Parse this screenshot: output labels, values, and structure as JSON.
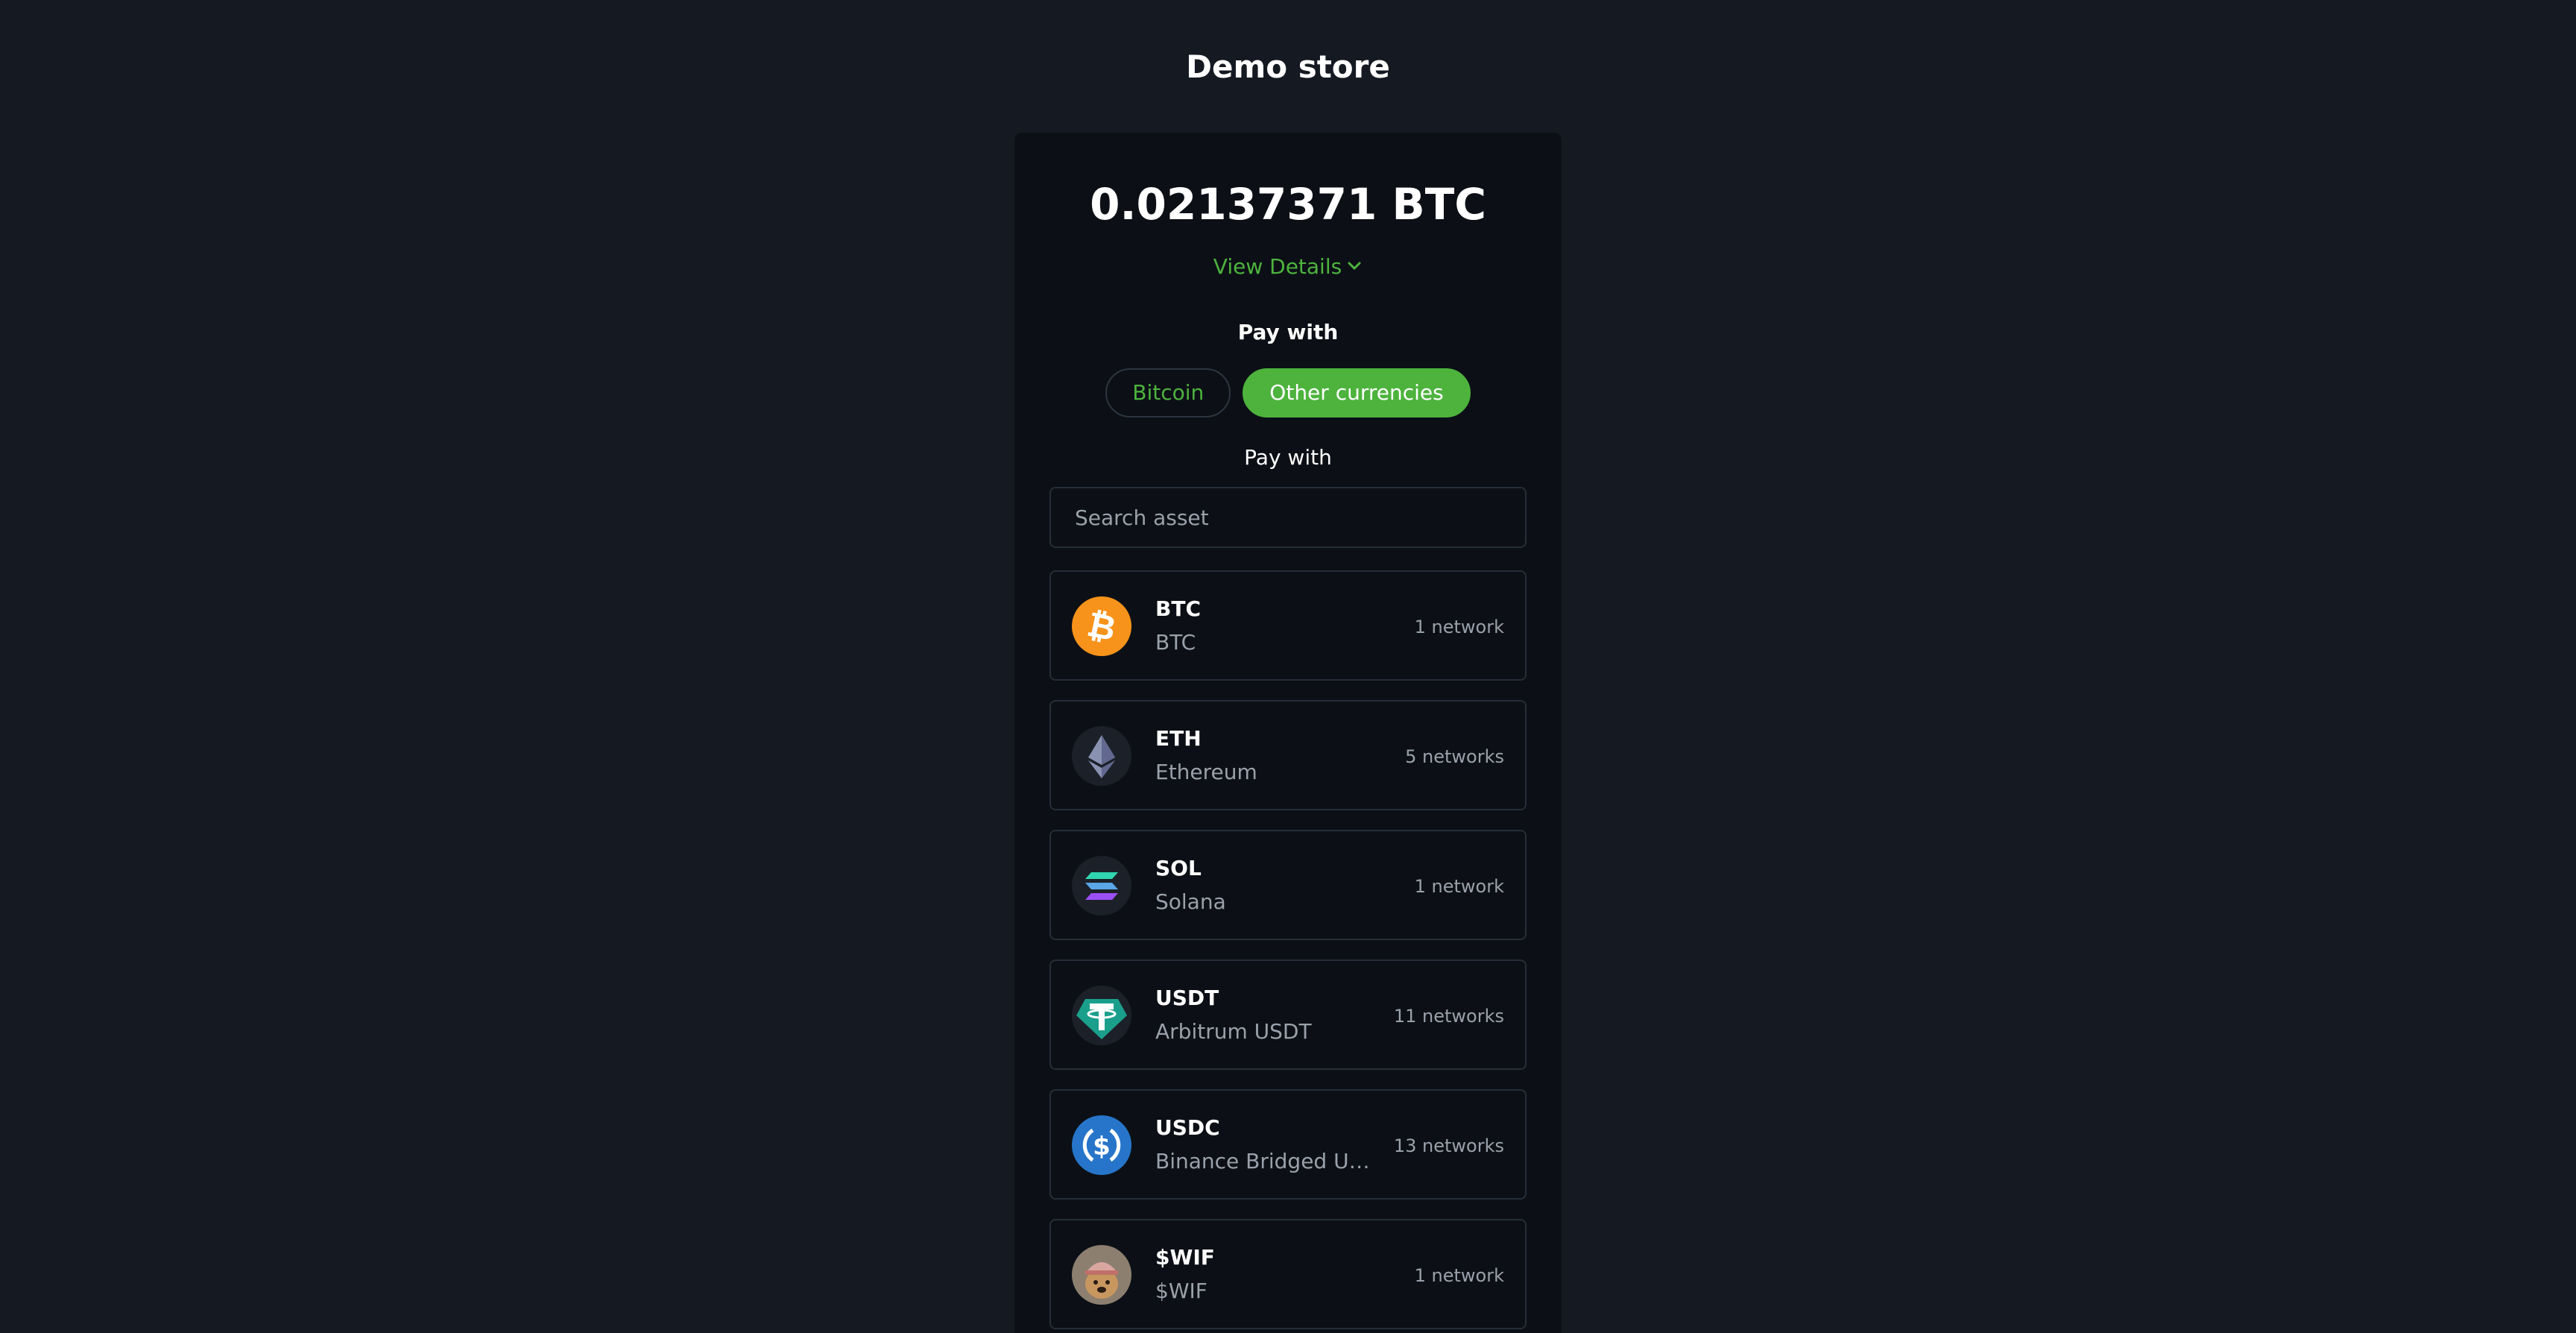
{
  "store": {
    "title": "Demo store"
  },
  "payment": {
    "amount": "0.02137371 BTC",
    "details_label": "View Details",
    "pay_with_label": "Pay with",
    "options": {
      "bitcoin": "Bitcoin",
      "other": "Other currencies"
    },
    "selected_option": "Other currencies",
    "pay_with_label_2": "Pay with"
  },
  "search": {
    "placeholder": "Search asset",
    "value": ""
  },
  "assets": [
    {
      "symbol": "BTC",
      "name": "BTC",
      "networks": "1 network",
      "icon": "bitcoin-icon"
    },
    {
      "symbol": "ETH",
      "name": "Ethereum",
      "networks": "5 networks",
      "icon": "ethereum-icon"
    },
    {
      "symbol": "SOL",
      "name": "Solana",
      "networks": "1 network",
      "icon": "solana-icon"
    },
    {
      "symbol": "USDT",
      "name": "Arbitrum USDT",
      "networks": "11 networks",
      "icon": "tether-icon"
    },
    {
      "symbol": "USDC",
      "name": "Binance Bridged US...",
      "networks": "13 networks",
      "icon": "usdc-icon"
    },
    {
      "symbol": "$WIF",
      "name": "$WIF",
      "networks": "1 network",
      "icon": "dogwifhat-icon"
    }
  ],
  "colors": {
    "background": "#151a22",
    "card": "#0c1016",
    "accent": "#4db33d",
    "muted_text": "#9aa1ab",
    "border": "#262d38"
  }
}
